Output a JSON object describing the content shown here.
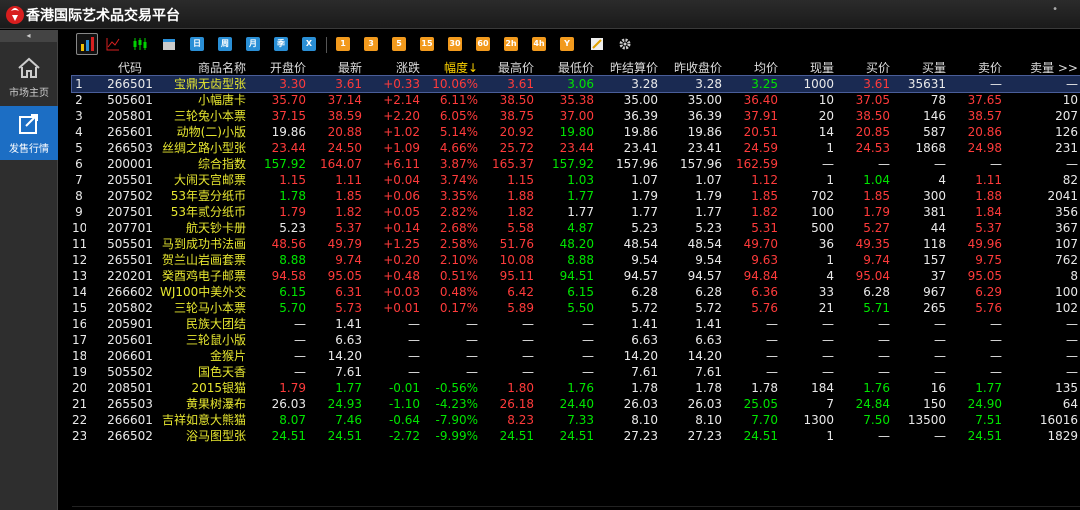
{
  "app": {
    "title": "香港国际艺术品交易平台"
  },
  "sidebar": {
    "collapse": "◂",
    "items": [
      {
        "label": "市场主页",
        "icon": "home-icon"
      },
      {
        "label": "发售行情",
        "icon": "export-icon"
      }
    ]
  },
  "toolbar": {
    "buttons": [
      "日",
      "周",
      "月",
      "季",
      "X",
      "1",
      "3",
      "5",
      "15",
      "30",
      "60",
      "2h",
      "4h",
      "Y"
    ]
  },
  "table": {
    "columns": [
      "代码",
      "商品名称",
      "开盘价",
      "最新",
      "涨跌",
      "幅度↓",
      "最高价",
      "最低价",
      "昨结算价",
      "昨收盘价",
      "均价",
      "现量",
      "买价",
      "买量",
      "卖价",
      "卖量 >>"
    ],
    "rows": [
      {
        "n": "1",
        "code": "266501",
        "name": "宝鼎无齿型张",
        "open": "3.30",
        "last": "3.61",
        "chg": "+0.33",
        "pct": "10.06%",
        "high": "3.61",
        "low": "3.06",
        "prevs": "3.28",
        "prevc": "3.28",
        "avg": "3.25",
        "vol": "1000",
        "bid": "3.61",
        "bidq": "35631",
        "ask": "—",
        "askq": "—"
      },
      {
        "n": "2",
        "code": "505601",
        "name": "小幅唐卡",
        "open": "35.70",
        "last": "37.14",
        "chg": "+2.14",
        "pct": "6.11%",
        "high": "38.50",
        "low": "35.38",
        "prevs": "35.00",
        "prevc": "35.00",
        "avg": "36.40",
        "vol": "10",
        "bid": "37.05",
        "bidq": "78",
        "ask": "37.65",
        "askq": "10"
      },
      {
        "n": "3",
        "code": "205801",
        "name": "三轮兔小本票",
        "open": "37.15",
        "last": "38.59",
        "chg": "+2.20",
        "pct": "6.05%",
        "high": "38.75",
        "low": "37.00",
        "prevs": "36.39",
        "prevc": "36.39",
        "avg": "37.91",
        "vol": "20",
        "bid": "38.50",
        "bidq": "146",
        "ask": "38.57",
        "askq": "207"
      },
      {
        "n": "4",
        "code": "265601",
        "name": "动物(二)小版",
        "open": "19.86",
        "last": "20.88",
        "chg": "+1.02",
        "pct": "5.14%",
        "high": "20.92",
        "low": "19.80",
        "prevs": "19.86",
        "prevc": "19.86",
        "avg": "20.51",
        "vol": "14",
        "bid": "20.85",
        "bidq": "587",
        "ask": "20.86",
        "askq": "126"
      },
      {
        "n": "5",
        "code": "266503",
        "name": "丝绸之路小型张",
        "open": "23.44",
        "last": "24.50",
        "chg": "+1.09",
        "pct": "4.66%",
        "high": "25.72",
        "low": "23.44",
        "prevs": "23.41",
        "prevc": "23.41",
        "avg": "24.59",
        "vol": "1",
        "bid": "24.53",
        "bidq": "1868",
        "ask": "24.98",
        "askq": "231"
      },
      {
        "n": "6",
        "code": "200001",
        "name": "综合指数",
        "open": "157.92",
        "last": "164.07",
        "chg": "+6.11",
        "pct": "3.87%",
        "high": "165.37",
        "low": "157.92",
        "prevs": "157.96",
        "prevc": "157.96",
        "avg": "162.59",
        "vol": "—",
        "bid": "—",
        "bidq": "—",
        "ask": "—",
        "askq": "—"
      },
      {
        "n": "7",
        "code": "205501",
        "name": "大闹天宫邮票",
        "open": "1.15",
        "last": "1.11",
        "chg": "+0.04",
        "pct": "3.74%",
        "high": "1.15",
        "low": "1.03",
        "prevs": "1.07",
        "prevc": "1.07",
        "avg": "1.12",
        "vol": "1",
        "bid": "1.04",
        "bidq": "4",
        "ask": "1.11",
        "askq": "82"
      },
      {
        "n": "8",
        "code": "207502",
        "name": "53年壹分纸币",
        "open": "1.78",
        "last": "1.85",
        "chg": "+0.06",
        "pct": "3.35%",
        "high": "1.88",
        "low": "1.77",
        "prevs": "1.79",
        "prevc": "1.79",
        "avg": "1.85",
        "vol": "702",
        "bid": "1.85",
        "bidq": "300",
        "ask": "1.88",
        "askq": "2041"
      },
      {
        "n": "9",
        "code": "207501",
        "name": "53年贰分纸币",
        "open": "1.79",
        "last": "1.82",
        "chg": "+0.05",
        "pct": "2.82%",
        "high": "1.82",
        "low": "1.77",
        "prevs": "1.77",
        "prevc": "1.77",
        "avg": "1.82",
        "vol": "100",
        "bid": "1.79",
        "bidq": "381",
        "ask": "1.84",
        "askq": "356"
      },
      {
        "n": "10",
        "code": "207701",
        "name": "航天钞卡册",
        "open": "5.23",
        "last": "5.37",
        "chg": "+0.14",
        "pct": "2.68%",
        "high": "5.58",
        "low": "4.87",
        "prevs": "5.23",
        "prevc": "5.23",
        "avg": "5.31",
        "vol": "500",
        "bid": "5.27",
        "bidq": "44",
        "ask": "5.37",
        "askq": "367"
      },
      {
        "n": "11",
        "code": "505501",
        "name": "马到成功书法画",
        "open": "48.56",
        "last": "49.79",
        "chg": "+1.25",
        "pct": "2.58%",
        "high": "51.76",
        "low": "48.20",
        "prevs": "48.54",
        "prevc": "48.54",
        "avg": "49.70",
        "vol": "36",
        "bid": "49.35",
        "bidq": "118",
        "ask": "49.96",
        "askq": "107"
      },
      {
        "n": "12",
        "code": "265501",
        "name": "贺兰山岩画套票",
        "open": "8.88",
        "last": "9.74",
        "chg": "+0.20",
        "pct": "2.10%",
        "high": "10.08",
        "low": "8.88",
        "prevs": "9.54",
        "prevc": "9.54",
        "avg": "9.63",
        "vol": "1",
        "bid": "9.74",
        "bidq": "157",
        "ask": "9.75",
        "askq": "762"
      },
      {
        "n": "13",
        "code": "220201",
        "name": "癸酉鸡电子邮票",
        "open": "94.58",
        "last": "95.05",
        "chg": "+0.48",
        "pct": "0.51%",
        "high": "95.11",
        "low": "94.51",
        "prevs": "94.57",
        "prevc": "94.57",
        "avg": "94.84",
        "vol": "4",
        "bid": "95.04",
        "bidq": "37",
        "ask": "95.05",
        "askq": "8"
      },
      {
        "n": "14",
        "code": "266602",
        "name": "WJ100中美外交封",
        "open": "6.15",
        "last": "6.31",
        "chg": "+0.03",
        "pct": "0.48%",
        "high": "6.42",
        "low": "6.15",
        "prevs": "6.28",
        "prevc": "6.28",
        "avg": "6.36",
        "vol": "33",
        "bid": "6.28",
        "bidq": "967",
        "ask": "6.29",
        "askq": "100"
      },
      {
        "n": "15",
        "code": "205802",
        "name": "三轮马小本票",
        "open": "5.70",
        "last": "5.73",
        "chg": "+0.01",
        "pct": "0.17%",
        "high": "5.89",
        "low": "5.50",
        "prevs": "5.72",
        "prevc": "5.72",
        "avg": "5.76",
        "vol": "21",
        "bid": "5.71",
        "bidq": "265",
        "ask": "5.76",
        "askq": "102"
      },
      {
        "n": "16",
        "code": "205901",
        "name": "民族大团结",
        "open": "—",
        "last": "1.41",
        "chg": "—",
        "pct": "—",
        "high": "—",
        "low": "—",
        "prevs": "1.41",
        "prevc": "1.41",
        "avg": "—",
        "vol": "—",
        "bid": "—",
        "bidq": "—",
        "ask": "—",
        "askq": "—"
      },
      {
        "n": "17",
        "code": "205601",
        "name": "三轮鼠小版",
        "open": "—",
        "last": "6.63",
        "chg": "—",
        "pct": "—",
        "high": "—",
        "low": "—",
        "prevs": "6.63",
        "prevc": "6.63",
        "avg": "—",
        "vol": "—",
        "bid": "—",
        "bidq": "—",
        "ask": "—",
        "askq": "—"
      },
      {
        "n": "18",
        "code": "206601",
        "name": "金猴片",
        "open": "—",
        "last": "14.20",
        "chg": "—",
        "pct": "—",
        "high": "—",
        "low": "—",
        "prevs": "14.20",
        "prevc": "14.20",
        "avg": "—",
        "vol": "—",
        "bid": "—",
        "bidq": "—",
        "ask": "—",
        "askq": "—"
      },
      {
        "n": "19",
        "code": "505502",
        "name": "国色天香",
        "open": "—",
        "last": "7.61",
        "chg": "—",
        "pct": "—",
        "high": "—",
        "low": "—",
        "prevs": "7.61",
        "prevc": "7.61",
        "avg": "—",
        "vol": "—",
        "bid": "—",
        "bidq": "—",
        "ask": "—",
        "askq": "—"
      },
      {
        "n": "20",
        "code": "208501",
        "name": "2015银猫",
        "open": "1.79",
        "last": "1.77",
        "chg": "-0.01",
        "pct": "-0.56%",
        "high": "1.80",
        "low": "1.76",
        "prevs": "1.78",
        "prevc": "1.78",
        "avg": "1.78",
        "vol": "184",
        "bid": "1.76",
        "bidq": "16",
        "ask": "1.77",
        "askq": "135"
      },
      {
        "n": "21",
        "code": "265503",
        "name": "黄果树瀑布",
        "open": "26.03",
        "last": "24.93",
        "chg": "-1.10",
        "pct": "-4.23%",
        "high": "26.18",
        "low": "24.40",
        "prevs": "26.03",
        "prevc": "26.03",
        "avg": "25.05",
        "vol": "7",
        "bid": "24.84",
        "bidq": "150",
        "ask": "24.90",
        "askq": "64"
      },
      {
        "n": "22",
        "code": "266601",
        "name": "吉祥如意大熊猫",
        "open": "8.07",
        "last": "7.46",
        "chg": "-0.64",
        "pct": "-7.90%",
        "high": "8.23",
        "low": "7.33",
        "prevs": "8.10",
        "prevc": "8.10",
        "avg": "7.70",
        "vol": "1300",
        "bid": "7.50",
        "bidq": "13500",
        "ask": "7.51",
        "askq": "16016"
      },
      {
        "n": "23",
        "code": "266502",
        "name": "浴马图型张",
        "open": "24.51",
        "last": "24.51",
        "chg": "-2.72",
        "pct": "-9.99%",
        "high": "24.51",
        "low": "24.51",
        "prevs": "27.23",
        "prevc": "27.23",
        "avg": "24.51",
        "vol": "1",
        "bid": "—",
        "bidq": "—",
        "ask": "24.51",
        "askq": "1829"
      }
    ]
  },
  "colors": {
    "up": "#ff3b3b",
    "down": "#00e600",
    "flat": "#eaeaea",
    "name": "#e6e630",
    "selected_row": "#1a2a52",
    "sidebar_active": "#1c6ec4"
  }
}
